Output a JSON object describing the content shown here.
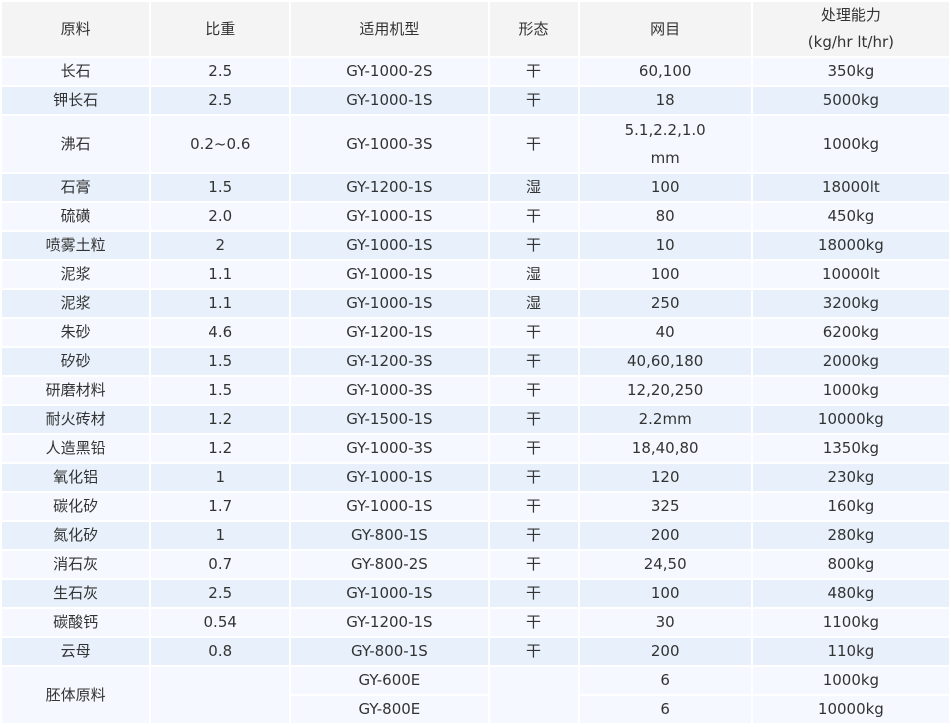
{
  "header": {
    "material": "原料",
    "density": "比重",
    "model": "适用机型",
    "form": "形态",
    "mesh": "网目",
    "capacity_line1": "处理能力",
    "capacity_line2": "(kg/hr lt/hr)"
  },
  "rows": [
    {
      "material": "长石",
      "density": "2.5",
      "model": "GY-1000-2S",
      "form": "干",
      "mesh": "60,100",
      "capacity": "350kg"
    },
    {
      "material": "钾长石",
      "density": "2.5",
      "model": "GY-1000-1S",
      "form": "干",
      "mesh": "18",
      "capacity": "5000kg"
    },
    {
      "material": "沸石",
      "density": "0.2~0.6",
      "model": "GY-1000-3S",
      "form": "干",
      "mesh_line1": "5.1,2.2,1.0",
      "mesh_line2": "mm",
      "capacity": "1000kg"
    },
    {
      "material": "石膏",
      "density": "1.5",
      "model": "GY-1200-1S",
      "form": "湿",
      "mesh": "100",
      "capacity": "18000lt"
    },
    {
      "material": "硫磺",
      "density": "2.0",
      "model": "GY-1000-1S",
      "form": "干",
      "mesh": "80",
      "capacity": "450kg"
    },
    {
      "material": "喷雾土粒",
      "density": "2",
      "model": "GY-1000-1S",
      "form": "干",
      "mesh": "10",
      "capacity": "18000kg"
    },
    {
      "material": "泥浆",
      "density": "1.1",
      "model": "GY-1000-1S",
      "form": "湿",
      "mesh": "100",
      "capacity": "10000lt"
    },
    {
      "material": "泥浆",
      "density": "1.1",
      "model": "GY-1000-1S",
      "form": "湿",
      "mesh": "250",
      "capacity": "3200kg"
    },
    {
      "material": "朱砂",
      "density": "4.6",
      "model": "GY-1200-1S",
      "form": "干",
      "mesh": "40",
      "capacity": "6200kg"
    },
    {
      "material": "矽砂",
      "density": "1.5",
      "model": "GY-1200-3S",
      "form": "干",
      "mesh": "40,60,180",
      "capacity": "2000kg"
    },
    {
      "material": "研磨材料",
      "density": "1.5",
      "model": "GY-1000-3S",
      "form": "干",
      "mesh": "12,20,250",
      "capacity": "1000kg"
    },
    {
      "material": "耐火砖材",
      "density": "1.2",
      "model": "GY-1500-1S",
      "form": "干",
      "mesh": "2.2mm",
      "capacity": "10000kg"
    },
    {
      "material": "人造黑铅",
      "density": "1.2",
      "model": "GY-1000-3S",
      "form": "干",
      "mesh": "18,40,80",
      "capacity": "1350kg"
    },
    {
      "material": "氧化铝",
      "density": "1",
      "model": "GY-1000-1S",
      "form": "干",
      "mesh": "120",
      "capacity": "230kg"
    },
    {
      "material": "碳化矽",
      "density": "1.7",
      "model": "GY-1000-1S",
      "form": "干",
      "mesh": "325",
      "capacity": "160kg"
    },
    {
      "material": "氮化矽",
      "density": "1",
      "model": "GY-800-1S",
      "form": "干",
      "mesh": "200",
      "capacity": "280kg"
    },
    {
      "material": "消石灰",
      "density": "0.7",
      "model": "GY-800-2S",
      "form": "干",
      "mesh": "24,50",
      "capacity": "800kg"
    },
    {
      "material": "生石灰",
      "density": "2.5",
      "model": "GY-1000-1S",
      "form": "干",
      "mesh": "100",
      "capacity": "480kg"
    },
    {
      "material": "碳酸钙",
      "density": "0.54",
      "model": "GY-1200-1S",
      "form": "干",
      "mesh": "30",
      "capacity": "1100kg"
    },
    {
      "material": "云母",
      "density": "0.8",
      "model": "GY-800-1S",
      "form": "干",
      "mesh": "200",
      "capacity": "110kg"
    }
  ],
  "last_group": {
    "material": "胚体原料",
    "rows": [
      {
        "model": "GY-600E",
        "mesh": "6",
        "capacity": "1000kg"
      },
      {
        "model": "GY-800E",
        "mesh": "6",
        "capacity": "10000kg"
      }
    ]
  }
}
